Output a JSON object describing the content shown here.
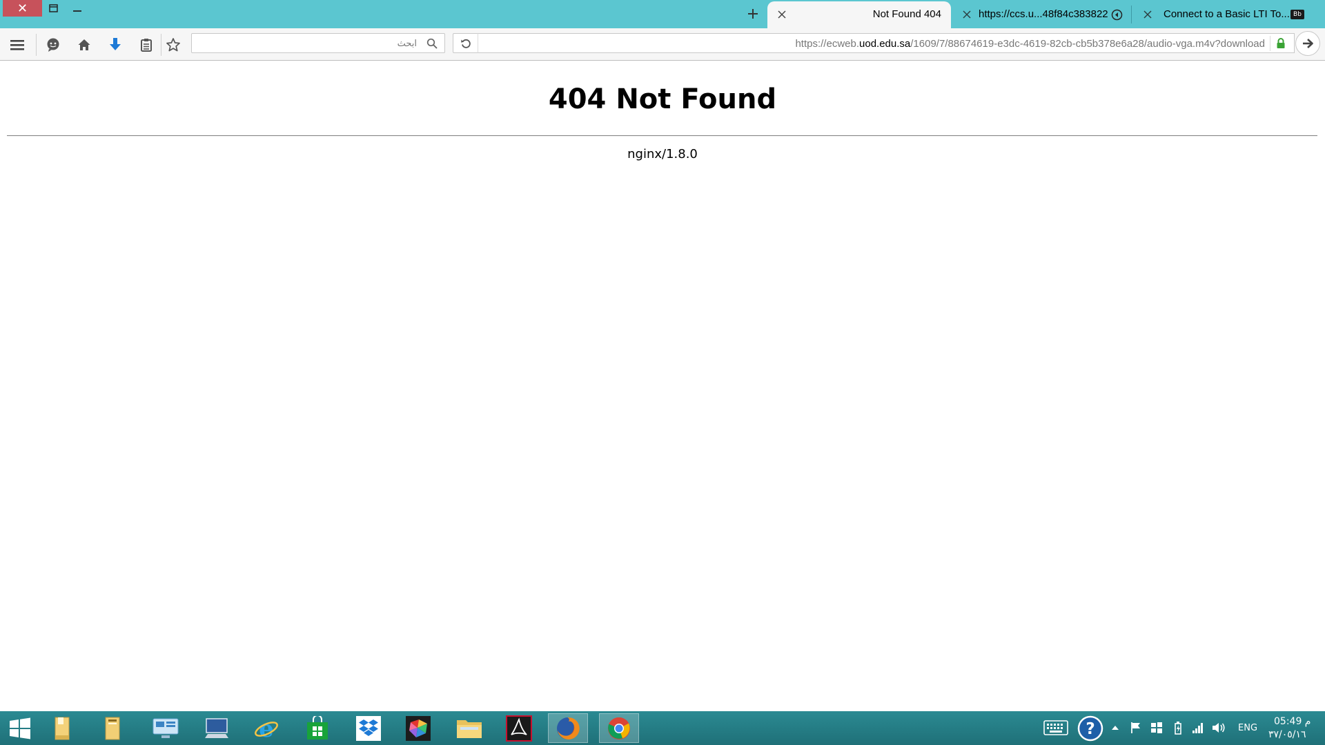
{
  "window": {
    "close_glyph": "✕"
  },
  "tabs": [
    {
      "title": "Not Found 404",
      "active": true
    },
    {
      "title": "https://ccs.u...48f84c383822",
      "active": false
    },
    {
      "title": "Connect to a Basic LTI To...",
      "active": false,
      "favicon_text": "Bb"
    }
  ],
  "toolbar": {
    "search_placeholder": "ابحث",
    "url_prefix": "https://ecweb.",
    "url_domain": "uod.edu.sa",
    "url_path": "/1609/7/88674619-e3dc-4619-82cb-cb5b378e6a28/audio-vga.m4v?download"
  },
  "page": {
    "heading": "404 Not Found",
    "server": "nginx/1.8.0"
  },
  "taskbar": {
    "apps": [
      "windows-start",
      "file-explorer-folder",
      "documents-folder",
      "remote-desktop",
      "computer",
      "internet-explorer",
      "windows-store",
      "dropbox",
      "paint-app",
      "folder",
      "adobe-acrobat",
      "firefox",
      "chrome"
    ],
    "language": "ENG",
    "time": "05:49 م",
    "date": "٣٧/٠٥/١٦"
  },
  "colors": {
    "tabbar": "#5bc6d0",
    "close_red": "#c7525b",
    "taskbar": "#1f7078",
    "download_blue": "#1e7ad6"
  }
}
